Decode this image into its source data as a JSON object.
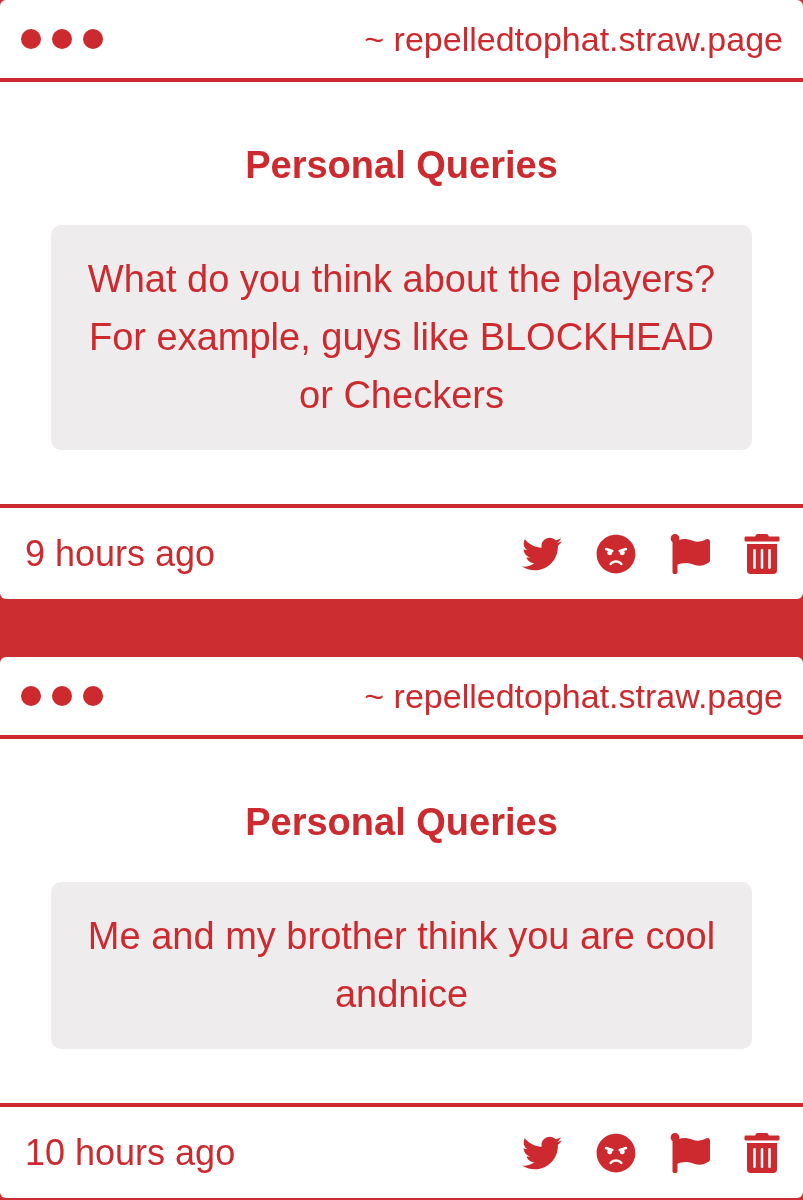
{
  "posts": [
    {
      "address": "~ repelledtophat.straw.page",
      "title": "Personal Queries",
      "question_lines": [
        "What do you think about the players?",
        "For example, guys like BLOCKHEAD",
        "or Checkers"
      ],
      "time": "9 hours ago"
    },
    {
      "address": "~ repelledtophat.straw.page",
      "title": "Personal Queries",
      "question_lines": [
        "Me and my brother think you are cool",
        "andnice"
      ],
      "time": "10 hours ago"
    }
  ]
}
